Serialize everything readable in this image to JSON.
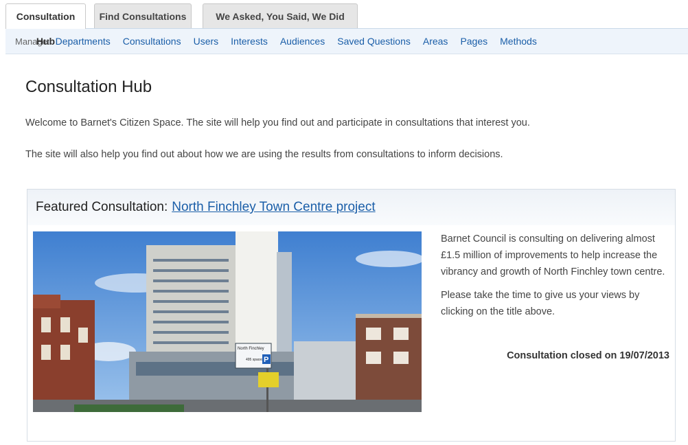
{
  "tabs": [
    {
      "label": "Consultation Hub",
      "active": true
    },
    {
      "label": "Find Consultations",
      "active": false
    },
    {
      "label": "We Asked, You Said, We Did",
      "active": false
    }
  ],
  "manage": {
    "label": "Manage:",
    "links": [
      "Departments",
      "Consultations",
      "Users",
      "Interests",
      "Audiences",
      "Saved Questions",
      "Areas",
      "Pages",
      "Methods"
    ]
  },
  "page": {
    "title": "Consultation Hub",
    "intro1": "Welcome to Barnet's Citizen Space. The site will help you find out and participate in consultations that interest you.",
    "intro2": "The site will also help you find out about how we are using the results from consultations to inform decisions."
  },
  "featured": {
    "heading": "Featured Consultation:",
    "link": "North Finchley Town Centre project",
    "desc1": "Barnet Council is consulting on delivering almost £1.5 million of improvements to help increase the vibrancy and growth of North Finchley town centre.",
    "desc2": "Please take the time to give us your views by clicking on the title above.",
    "closed": "Consultation closed on 19/07/2013",
    "sign_line1": "North Finchley",
    "sign_line2": "495 spaces",
    "sign_p": "P"
  },
  "colors": {
    "link": "#1a5ea8",
    "manage_bg": "#eef4fb",
    "sky": "#5e93d6"
  }
}
